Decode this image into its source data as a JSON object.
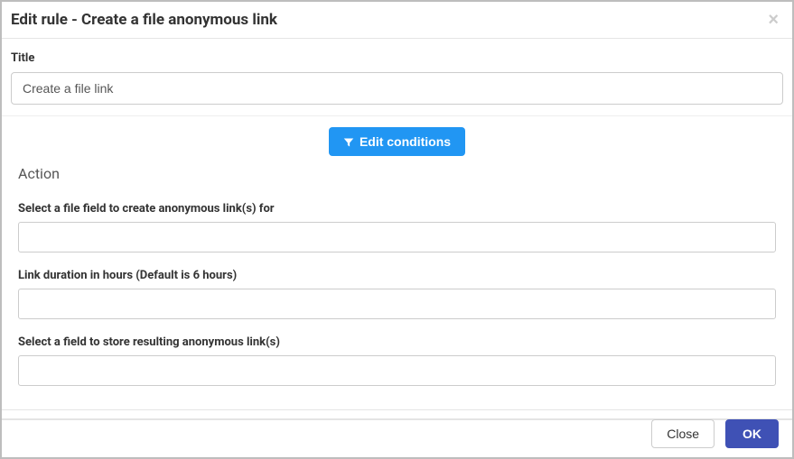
{
  "header": {
    "title": "Edit rule - Create a file anonymous link",
    "close_symbol": "×"
  },
  "title_field": {
    "label": "Title",
    "value": "Create a file link"
  },
  "conditions": {
    "button_label": "Edit conditions"
  },
  "action": {
    "header": "Action",
    "fields": {
      "file_field": {
        "label": "Select a file field to create anonymous link(s) for",
        "value": ""
      },
      "duration": {
        "label": "Link duration in hours (Default is 6 hours)",
        "value": ""
      },
      "store_field": {
        "label": "Select a field to store resulting anonymous link(s)",
        "value": ""
      }
    }
  },
  "footer": {
    "close_label": "Close",
    "ok_label": "OK"
  }
}
